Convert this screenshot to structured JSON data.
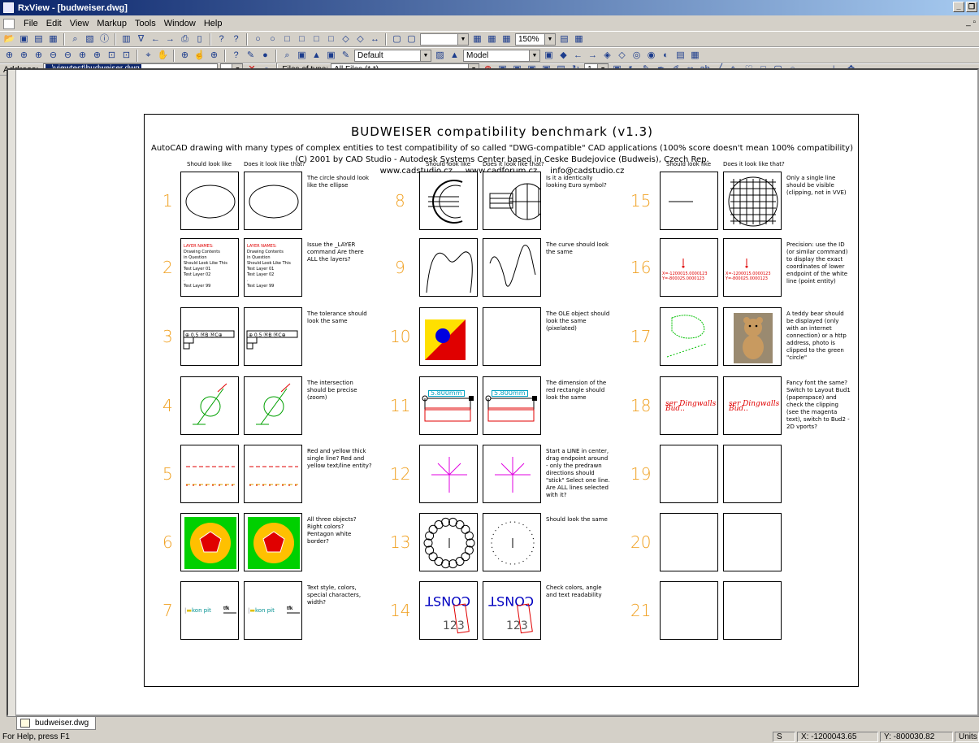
{
  "window": {
    "title": "RxView - [budweiser.dwg]"
  },
  "menu": [
    "File",
    "Edit",
    "View",
    "Markup",
    "Tools",
    "Window",
    "Help"
  ],
  "toolbar": {
    "zoom": "150%",
    "layer": "Default",
    "space": "Model"
  },
  "addressbar": {
    "label": "Address:",
    "value": "..\\viewtest\\budweiser.dwg",
    "files_label": "Files of type:",
    "files_value": "All Files (*.*)",
    "page": "1"
  },
  "sheet": {
    "title": "BUDWEISER compatibility benchmark (v1.3)",
    "subtitle": "AutoCAD drawing with many types of complex entities to test compatibility of so called \"DWG-compatible\" CAD applications (100% score doesn't mean 100% compatibility)",
    "copyright": "(C) 2001 by CAD Studio - Autodesk Systems Center based in Ceske Budejovice (Budweis), Czech Rep.",
    "links": "www.cadstudio.cz     www.cadforum.cz     info@cadstudio.cz",
    "col_a": "Should look like",
    "col_b": "Does it look like that?",
    "tests": [
      {
        "n": "1",
        "note": "The circle should look like the ellipse"
      },
      {
        "n": "2",
        "note": "Issue the _LAYER command Are there ALL the layers?"
      },
      {
        "n": "3",
        "note": "The tolerance should look the same"
      },
      {
        "n": "4",
        "note": "The intersection should be precise (zoom)"
      },
      {
        "n": "5",
        "note": "Red and yellow thick single line? Red and yellow text/line entity?"
      },
      {
        "n": "6",
        "note": "All three objects? Right colors? Pentagon white border?"
      },
      {
        "n": "7",
        "note": "Text style, colors, special characters, width?"
      },
      {
        "n": "8",
        "note": "Is it a identically looking Euro symbol?"
      },
      {
        "n": "9",
        "note": "The curve should look the same"
      },
      {
        "n": "10",
        "note": "The OLE object should look the same (pixelated)"
      },
      {
        "n": "11",
        "note": "The dimension of the red rectangle should look the same"
      },
      {
        "n": "12",
        "note": "Start a LINE in center, drag endpoint around - only the predrawn directions should \"stick\" Select one line. Are ALL lines selected with it?"
      },
      {
        "n": "13",
        "note": "Should look the same"
      },
      {
        "n": "14",
        "note": "Check colors, angle and text readability"
      },
      {
        "n": "15",
        "note": "Only a single line should be visible (clipping, not in VVE)"
      },
      {
        "n": "16",
        "note": "Precision: use the ID (or similar command) to display the exact coordinates of lower endpoint of the white line (point entity)"
      },
      {
        "n": "17",
        "note": "A teddy bear should be displayed (only with an internet connection) or a http address, photo is clipped to the green \"circle\""
      },
      {
        "n": "18",
        "note": "Fancy font the same? Switch to Layout Bud1 (paperspace) and check the clipping (see the magenta text), switch to Bud2 - 2D vports?"
      },
      {
        "n": "19",
        "note": ""
      },
      {
        "n": "20",
        "note": ""
      },
      {
        "n": "21",
        "note": ""
      }
    ],
    "layer_list": [
      "LAYER NAMES:",
      "Drawing Contents",
      "in Question",
      "Should Look Like This",
      "Test Layer 01",
      "Test Layer 02",
      ".",
      "Test Layer 99"
    ],
    "dim_value": "5.800mm",
    "coords": [
      "X=-1200015.0000123",
      "Y=-800025.0000123"
    ],
    "fancy_text": "ser Dingwalls Bud..",
    "text7": "kon pit"
  },
  "tabs": [
    "budweiser.dwg"
  ],
  "status": {
    "help": "For Help, press F1",
    "s": "S",
    "x": "X: -1200043.65",
    "y": "Y: -800030.82",
    "units": "Units"
  }
}
